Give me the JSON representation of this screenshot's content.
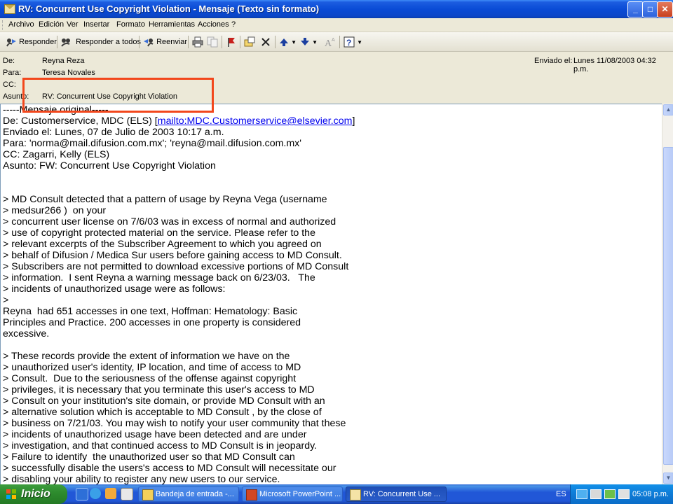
{
  "window": {
    "title": "RV: Concurrent Use Copyright Violation - Mensaje (Texto sin formato)",
    "minimize": "_",
    "maximize": "□",
    "close": "✕"
  },
  "menu": [
    "Archivo",
    "Edición",
    "Ver",
    "Insertar",
    "Formato",
    "Herramientas",
    "Acciones",
    "?"
  ],
  "toolbar": {
    "reply": "Responder",
    "reply_all": "Responder a todos",
    "forward": "Reenviar"
  },
  "header": {
    "from_label": "De:",
    "from_value": "Reyna Reza",
    "to_label": "Para:",
    "to_value": "Teresa Novales",
    "cc_label": "CC:",
    "cc_value": "",
    "subject_label": "Asunto:",
    "subject_value": "RV: Concurrent Use Copyright Violation",
    "sent_label": "Enviado el:",
    "sent_value": "Lunes 11/08/2003 04:32 p.m."
  },
  "body": {
    "lines": [
      "-----Mensaje original-----",
      "",
      "Enviado el: Lunes, 07 de Julio de 2003 10:17 a.m.",
      "Para: 'norma@mail.difusion.com.mx'; 'reyna@mail.difusion.com.mx'",
      "CC: Zagarri, Kelly (ELS)",
      "Asunto: FW: Concurrent Use Copyright Violation",
      "",
      "",
      "> MD Consult detected that a pattern of usage by Reyna Vega (username",
      "> medsur266 )  on your",
      "> concurrent user license on 7/6/03 was in excess of normal and authorized",
      "> use of copyright protected material on the service. Please refer to the",
      "> relevant excerpts of the Subscriber Agreement to which you agreed on",
      "> behalf of Difusion / Medica Sur users before gaining access to MD Consult.",
      "> Subscribers are not permitted to download excessive portions of MD Consult",
      "> information.  I sent Reyna a warning message back on 6/23/03.   The",
      "> incidents of unauthorized usage were as follows:",
      ">",
      "Reyna  had 651 accesses in one text, Hoffman: Hematology: Basic",
      "Principles and Practice. 200 accesses in one property is considered",
      "excessive.",
      "",
      "> These records provide the extent of information we have on the",
      "> unauthorized user's identity, IP location, and time of access to MD",
      "> Consult.  Due to the seriousness of the offense against copyright",
      "> privileges, it is necessary that you terminate this user's access to MD",
      "> Consult on your institution's site domain, or provide MD Consult with an",
      "> alternative solution which is acceptable to MD Consult , by the close of",
      "> business on 7/21/03. You may wish to notify your user community that these",
      "> incidents of unauthorized usage have been detected and are under",
      "> investigation, and that continued access to MD Consult is in jeopardy.",
      "> Failure to identify  the unauthorized user so that MD Consult can",
      "> successfully disable the users's access to MD Consult will necessitate our",
      "> disabling your ability to register any new users to our service."
    ],
    "from_prefix": "De: Customerservice, MDC (ELS) [",
    "from_link": "mailto:MDC.Customerservice@elsevier.com",
    "from_suffix": "]"
  },
  "taskbar": {
    "start": "Inicio",
    "tasks": [
      "Bandeja de entrada -...",
      "Microsoft PowerPoint ...",
      "RV: Concurrent Use ..."
    ],
    "lang": "ES",
    "clock": "05:08 p.m."
  }
}
